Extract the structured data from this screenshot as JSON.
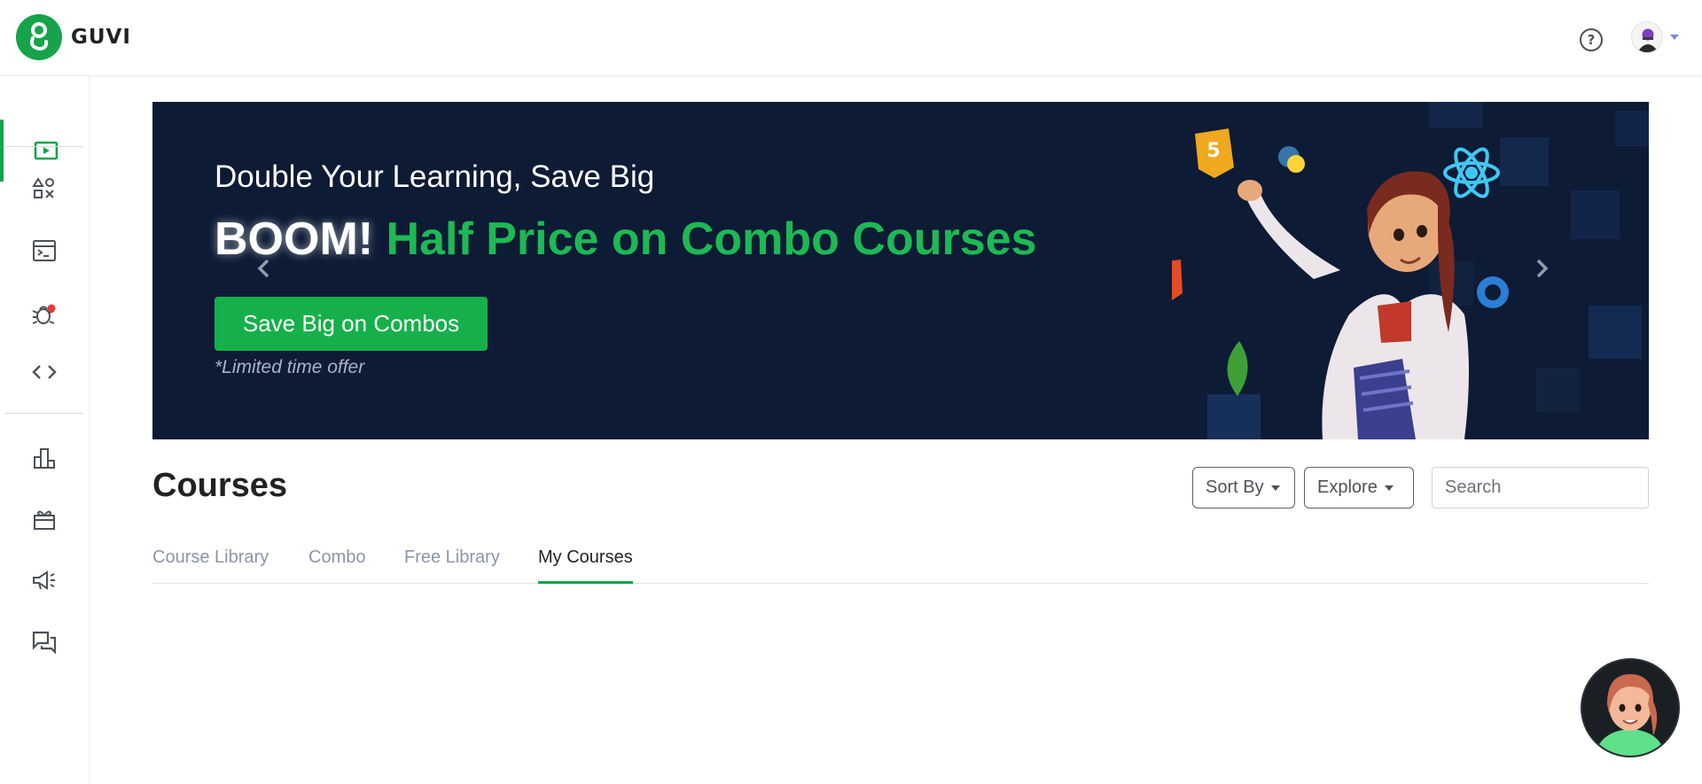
{
  "app": {
    "logo_text": "GUVI",
    "brand_color": "#16a34a"
  },
  "header": {
    "help_icon": "help-circle-icon",
    "help_glyph": "?",
    "avatar": "user-avatar"
  },
  "sidebar": {
    "items": [
      {
        "name": "video",
        "icon": "play-video-icon"
      },
      {
        "name": "shapes",
        "icon": "shapes-icon"
      },
      {
        "name": "terminal",
        "icon": "terminal-icon"
      },
      {
        "name": "bug",
        "icon": "bug-icon"
      },
      {
        "name": "code",
        "icon": "code-brackets-icon"
      },
      {
        "name": "leaderboard",
        "icon": "leaderboard-icon"
      },
      {
        "name": "rewards",
        "icon": "gift-icon"
      },
      {
        "name": "announcements",
        "icon": "megaphone-icon"
      },
      {
        "name": "forum",
        "icon": "chat-icon"
      }
    ]
  },
  "banner": {
    "subtitle": "Double Your Learning, Save Big",
    "headline_boom": "BOOM!",
    "headline_rest": "Half Price on Combo Courses",
    "button_label": "Save Big on Combos",
    "note": "*Limited time offer",
    "bg_color": "#0d1b35",
    "accent_color": "#1db954"
  },
  "courses": {
    "title": "Courses",
    "sort_label": "Sort By",
    "explore_label": "Explore",
    "search_placeholder": "Search",
    "tabs": [
      {
        "label": "Course Library",
        "active": false
      },
      {
        "label": "Combo",
        "active": false
      },
      {
        "label": "Free Library",
        "active": false
      },
      {
        "label": "My Courses",
        "active": true
      }
    ]
  }
}
